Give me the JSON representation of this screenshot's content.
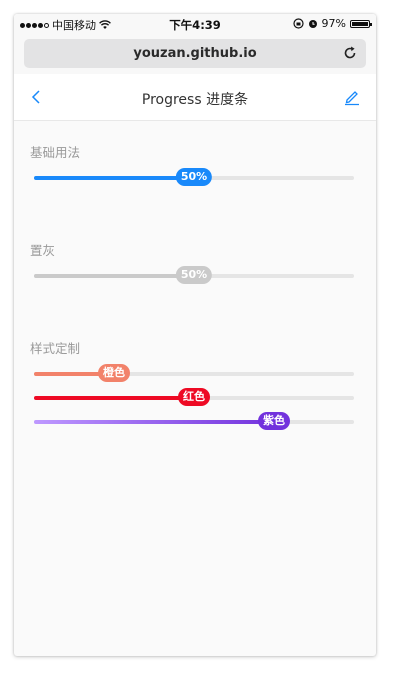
{
  "status_bar": {
    "carrier": "中国移动",
    "time": "下午4:39",
    "battery_text": "97%",
    "battery_level": 0.97,
    "icons": [
      "signal-icon",
      "wifi-icon",
      "rotation-lock-icon",
      "alarm-icon",
      "battery-icon"
    ]
  },
  "browser": {
    "url": "youzan.github.io",
    "reload_icon": "reload-icon"
  },
  "nav": {
    "title": "Progress 进度条",
    "back_icon": "chevron-left-icon",
    "edit_icon": "edit-icon"
  },
  "sections": [
    {
      "title": "基础用法",
      "bars": [
        {
          "percentage": 50,
          "pivot_text": "50%",
          "color": "#1989fa",
          "track_color": "#e5e5e5"
        }
      ]
    },
    {
      "title": "置灰",
      "bars": [
        {
          "percentage": 50,
          "pivot_text": "50%",
          "color": "#cacaca",
          "track_color": "#e5e5e5"
        }
      ]
    },
    {
      "title": "样式定制",
      "bars": [
        {
          "percentage": 25,
          "pivot_text": "橙色",
          "color": "#f2826a",
          "track_color": "#e5e5e5"
        },
        {
          "percentage": 50,
          "pivot_text": "红色",
          "color": "#ee0a24",
          "track_color": "#e5e5e5"
        },
        {
          "percentage": 75,
          "pivot_text": "紫色",
          "color": "linear-gradient(to right, #be99ff, #7232dd)",
          "pivot_color": "#7232dd",
          "track_color": "#e5e5e5"
        }
      ]
    }
  ],
  "colors": {
    "accent": "#1989fa",
    "orange": "#f2826a",
    "red": "#e55a4b",
    "purple": "#7232dd",
    "gray": "#cacaca"
  }
}
